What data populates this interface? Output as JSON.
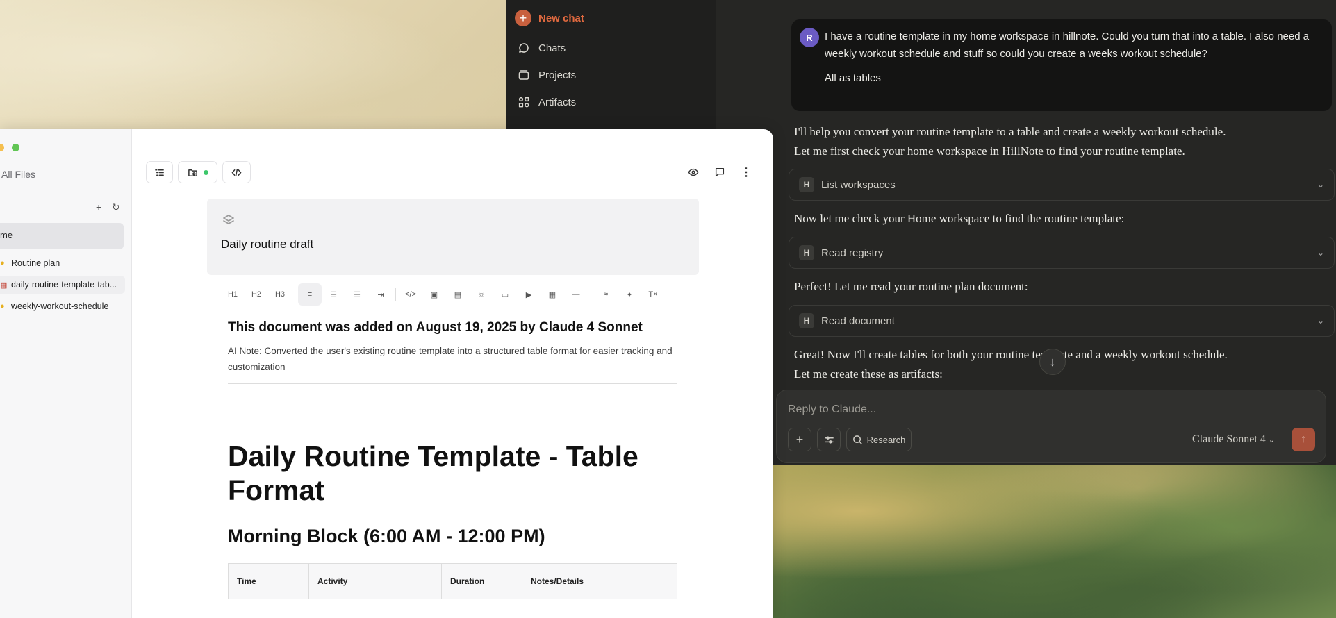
{
  "claude_sidebar": {
    "new_chat": "New chat",
    "items": [
      {
        "label": "Chats",
        "icon": "chat-bubble-icon"
      },
      {
        "label": "Projects",
        "icon": "folder-stack-icon"
      },
      {
        "label": "Artifacts",
        "icon": "grid-shapes-icon"
      }
    ]
  },
  "chat": {
    "user_avatar_initial": "R",
    "user_message": "I have a routine template in my home workspace in hillnote. Could you turn that into a table. I also need a weekly workout schedule and stuff so could you create a weeks workout schedule?",
    "user_message_extra": "All as tables",
    "assistant_1a": "I'll help you convert your routine template to a table and create a weekly workout schedule.",
    "assistant_1b": "Let me first check your home workspace in HillNote to find your routine template.",
    "tool_1": "List workspaces",
    "assistant_2": "Now let me check your Home workspace to find the routine template:",
    "tool_2": "Read registry",
    "assistant_3": "Perfect! Let me read your routine plan document:",
    "tool_3": "Read document",
    "assistant_4a": "Great! Now I'll create tables for both your routine template and a weekly workout schedule.",
    "assistant_4b": "Let me create these as artifacts:",
    "tool_badge": "H"
  },
  "composer": {
    "placeholder": "Reply to Claude...",
    "research_label": "Research",
    "model": "Claude Sonnet 4"
  },
  "hillnote": {
    "sidebar": {
      "all_files": "All Files",
      "workspace_label": "me",
      "files": [
        {
          "label": "Routine plan",
          "icon": "document-icon"
        },
        {
          "label": "daily-routine-template-tab...",
          "icon": "calendar-icon"
        },
        {
          "label": "weekly-workout-schedule",
          "icon": "document-icon"
        }
      ]
    },
    "doc_title": "Daily routine draft",
    "format_bar": [
      "H1",
      "H2",
      "H3"
    ],
    "doc": {
      "added_line": "This document was added on August 19, 2025 by Claude 4 Sonnet",
      "ai_note": "AI Note: Converted the user's existing routine template into a structured table format for easier tracking and customization",
      "h1": "Daily Routine Template - Table Format",
      "h2": "Morning Block (6:00 AM - 12:00 PM)",
      "table_headers": [
        "Time",
        "Activity",
        "Duration",
        "Notes/Details"
      ]
    }
  },
  "colors": {
    "claude_bg": "#262624",
    "claude_sidebar_bg": "#1f1f1e",
    "accent_orange": "#c8603e",
    "send_button": "#a8503a",
    "avatar_purple": "#6b5bc4",
    "hillnote_bg": "#ffffff",
    "status_dot_green": "#3cc76a"
  }
}
